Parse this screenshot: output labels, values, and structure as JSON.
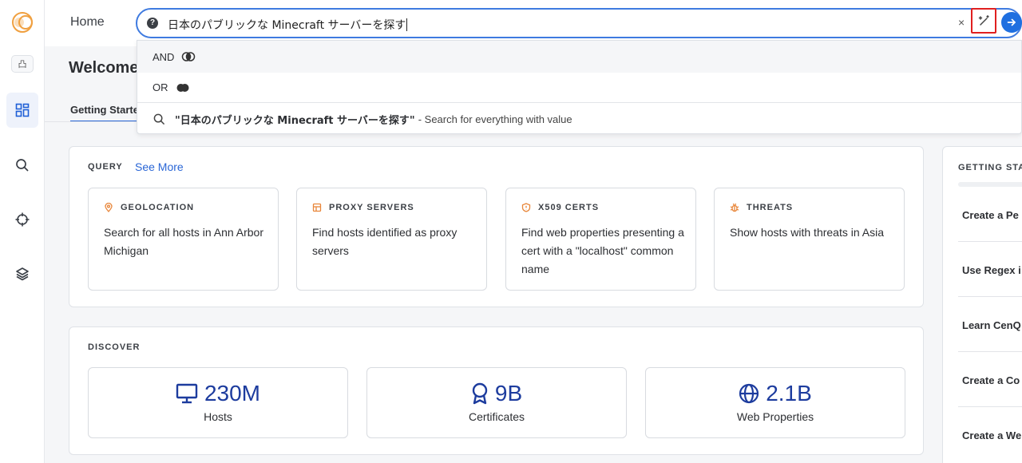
{
  "header": {
    "home_label": "Home",
    "search": {
      "value": "日本のパブリックな Minecraft サーバーを探す",
      "help_glyph": "?",
      "clear_glyph": "×"
    }
  },
  "dropdown": {
    "and_label": "AND",
    "or_label": "OR",
    "search_all": {
      "query": "\"日本のパブリックな Minecraft サーバーを探す\"",
      "suffix": "- Search for everything with value"
    }
  },
  "sidebar": {
    "org_icon_glyph": "凸"
  },
  "main": {
    "welcome_title": "Welcome",
    "tab_getting_started": "Getting Starte",
    "query_panel": {
      "label": "QUERY",
      "see_more": "See More",
      "cards": [
        {
          "icon": "location-pin-icon",
          "title": "GEOLOCATION",
          "desc": "Search for all hosts in Ann Arbor Michigan"
        },
        {
          "icon": "proxy-server-icon",
          "title": "PROXY SERVERS",
          "desc": "Find hosts identified as proxy servers"
        },
        {
          "icon": "shield-alert-icon",
          "title": "X509 CERTS",
          "desc": "Find web properties presenting a cert with a \"localhost\" common name"
        },
        {
          "icon": "bug-icon",
          "title": "THREATS",
          "desc": "Show hosts with threats in Asia"
        }
      ]
    },
    "discover_panel": {
      "label": "DISCOVER",
      "cards": [
        {
          "icon": "monitor-icon",
          "value": "230M",
          "label": "Hosts"
        },
        {
          "icon": "certificate-icon",
          "value": "9B",
          "label": "Certificates"
        },
        {
          "icon": "globe-icon",
          "value": "2.1B",
          "label": "Web Properties"
        }
      ]
    }
  },
  "right_panel": {
    "title": "GETTING STA",
    "items": [
      "Create a Pe",
      "Use Regex i",
      "Learn CenQ",
      "Create a Co",
      "Create a We"
    ]
  },
  "colors": {
    "accent": "#1f6fe0",
    "link": "#2a66d6",
    "stat_value": "#1d3c9e",
    "card_icon": "#e8863a",
    "highlight_box": "#e02020"
  }
}
